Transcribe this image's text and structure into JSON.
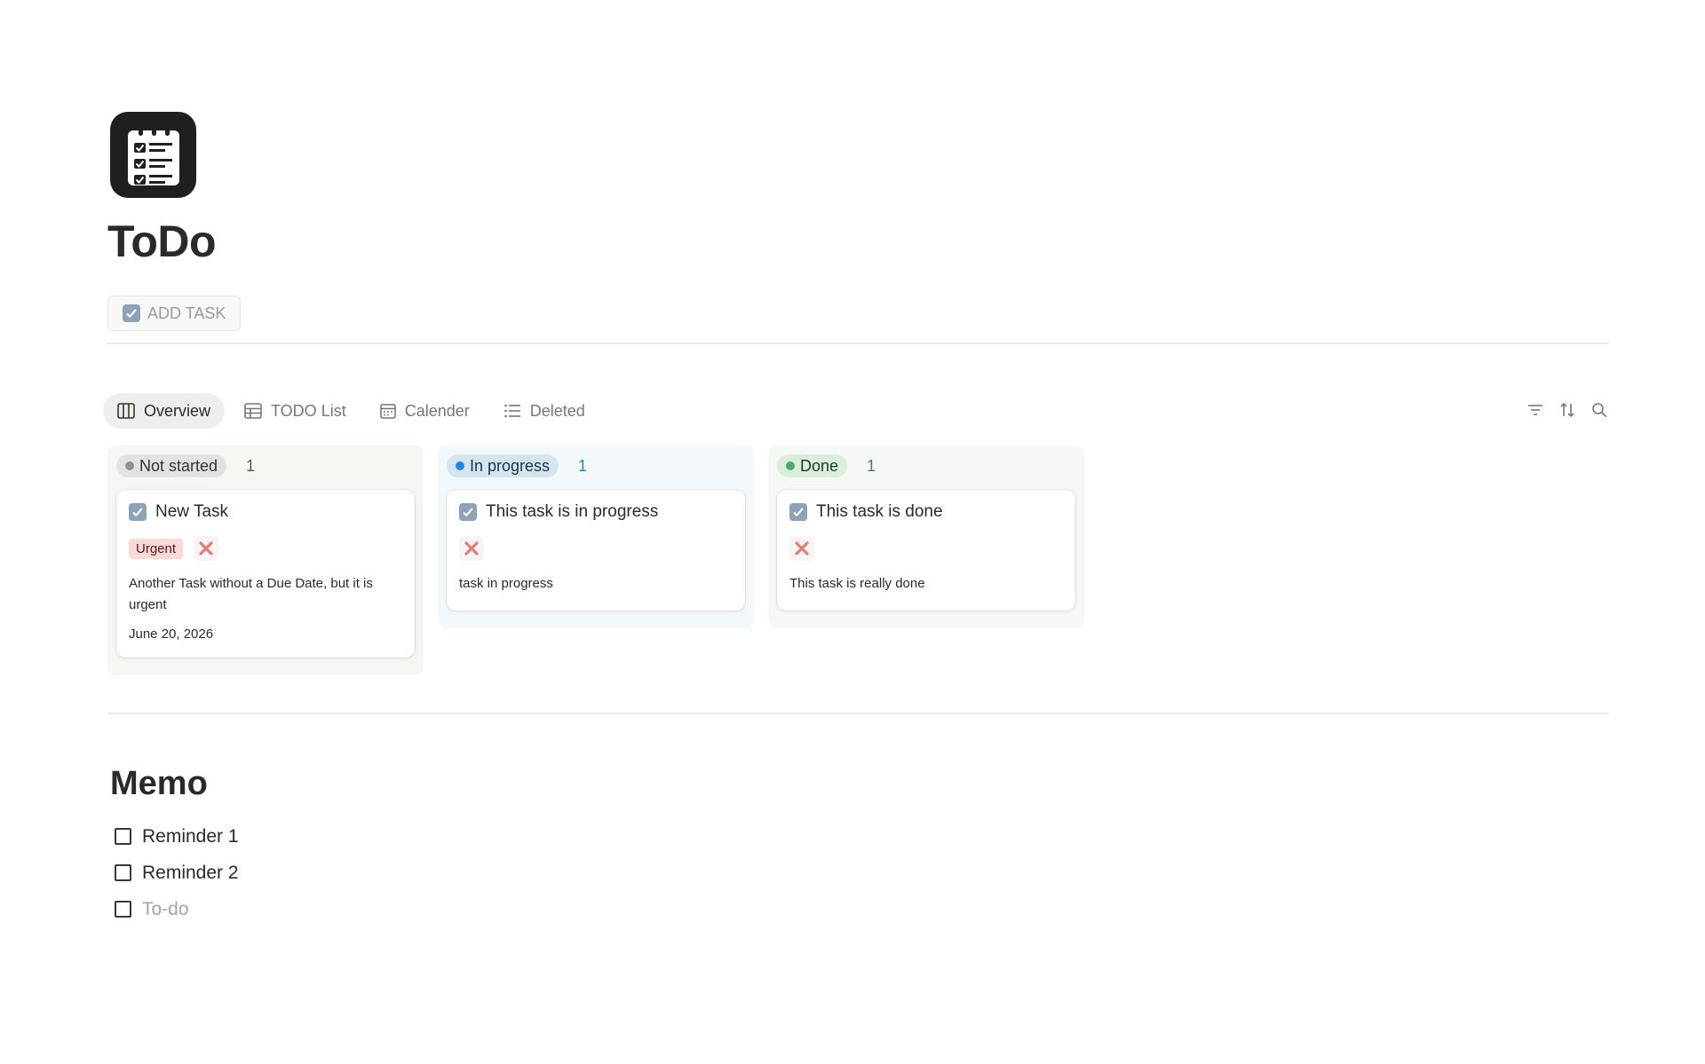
{
  "page": {
    "icon": "checklist-notepad-icon",
    "title": "ToDo"
  },
  "add_task": {
    "icon": "check-box-emoji-icon",
    "label": "ADD TASK"
  },
  "views": [
    {
      "label": "Overview",
      "icon": "board-columns-icon",
      "active": true
    },
    {
      "label": "TODO List",
      "icon": "table-icon",
      "active": false
    },
    {
      "label": "Calender",
      "icon": "calendar-icon",
      "active": false
    },
    {
      "label": "Deleted",
      "icon": "list-icon",
      "active": false
    }
  ],
  "toolbar": {
    "filter_icon": "filter-icon",
    "sort_icon": "sort-icon",
    "search_icon": "search-icon"
  },
  "board": {
    "columns": [
      {
        "status": "Not started",
        "count": "1",
        "color": "#91918e",
        "pill_bg": "#e3e2e0",
        "col_bg": "#f7f6f3",
        "count_color": "#5a5955",
        "card": {
          "title": "New Task",
          "tag": "Urgent",
          "description": "Another Task without a Due Date, but it is urgent",
          "date": "June 20, 2026"
        }
      },
      {
        "status": "In progress",
        "count": "1",
        "color": "#2383e2",
        "pill_bg": "#d3e5ef",
        "col_bg": "#f3f8fb",
        "count_color": "#2f80c4",
        "card": {
          "title": "This task is in progress",
          "description": "task in progress"
        }
      },
      {
        "status": "Done",
        "count": "1",
        "color": "#4dab6f",
        "pill_bg": "#dbeddb",
        "col_bg": "#f5f8f5",
        "count_color": "#448361",
        "card": {
          "title": "This task is done",
          "description": "This task is really done"
        }
      }
    ]
  },
  "memo": {
    "title": "Memo",
    "items": [
      {
        "label": "Reminder 1",
        "checked": false
      },
      {
        "label": "Reminder 2",
        "checked": false
      }
    ],
    "placeholder": "To-do"
  }
}
